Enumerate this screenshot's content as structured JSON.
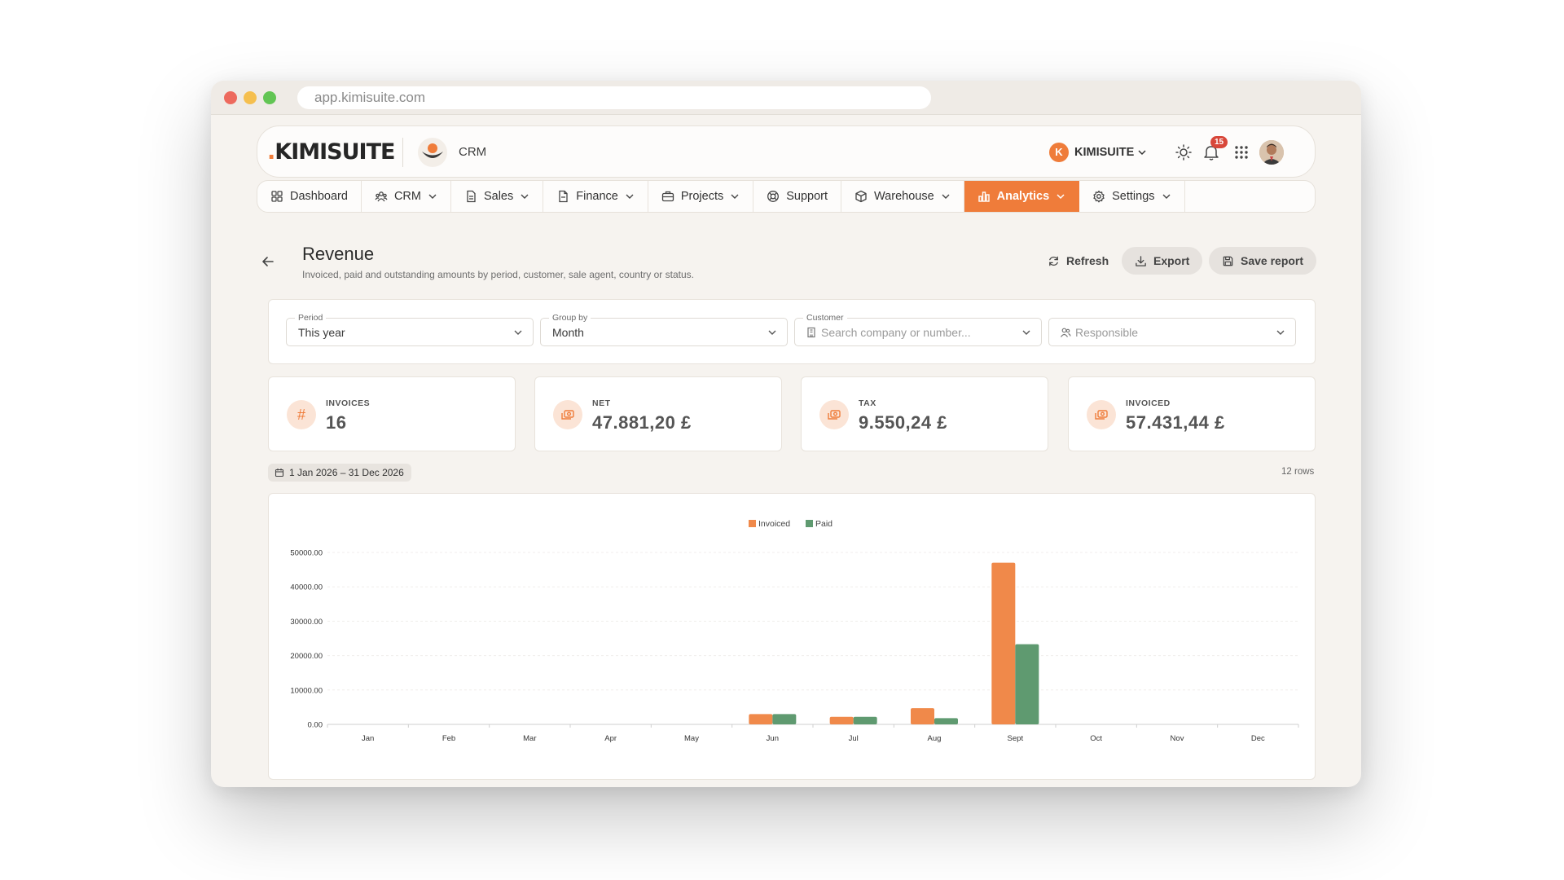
{
  "browser": {
    "url": "app.kimisuite.com"
  },
  "appbar": {
    "logo_text": ".KIMISUITE",
    "module_label": "CRM",
    "tenant_initial": "K",
    "tenant_name": "KIMISUITE",
    "notification_count": "15"
  },
  "nav": {
    "items": [
      {
        "label": "Dashboard",
        "icon": "grid-icon",
        "dropdown": false
      },
      {
        "label": "CRM",
        "icon": "users-icon",
        "dropdown": true
      },
      {
        "label": "Sales",
        "icon": "document-icon",
        "dropdown": true
      },
      {
        "label": "Finance",
        "icon": "invoice-icon",
        "dropdown": true
      },
      {
        "label": "Projects",
        "icon": "briefcase-icon",
        "dropdown": true
      },
      {
        "label": "Support",
        "icon": "lifebuoy-icon",
        "dropdown": false
      },
      {
        "label": "Warehouse",
        "icon": "box-icon",
        "dropdown": true
      },
      {
        "label": "Analytics",
        "icon": "bar-chart-icon",
        "dropdown": true,
        "active": true
      },
      {
        "label": "Settings",
        "icon": "gear-icon",
        "dropdown": true
      }
    ]
  },
  "page": {
    "title": "Revenue",
    "subtitle": "Invoiced, paid and outstanding amounts by period, customer, sale agent, country or status.",
    "refresh_label": "Refresh",
    "export_label": "Export",
    "save_label": "Save report"
  },
  "filters": {
    "period": {
      "label": "Period",
      "value": "This year"
    },
    "group_by": {
      "label": "Group by",
      "value": "Month"
    },
    "customer": {
      "label": "Customer",
      "placeholder": "Search company or number..."
    },
    "responsible": {
      "placeholder": "Responsible"
    }
  },
  "kpis": [
    {
      "label": "INVOICES",
      "value": "16",
      "icon": "hash-icon"
    },
    {
      "label": "NET",
      "value": "47.881,20 £",
      "icon": "money-icon"
    },
    {
      "label": "TAX",
      "value": "9.550,24 £",
      "icon": "money-icon"
    },
    {
      "label": "INVOICED",
      "value": "57.431,44 £",
      "icon": "money-icon"
    }
  ],
  "date_range": "1 Jan 2026 – 31 Dec 2026",
  "rows_count": "12 rows",
  "colors": {
    "accent": "#ef7c3a",
    "invoiced": "#f0894a",
    "paid": "#5f9a70"
  },
  "chart_data": {
    "type": "bar",
    "categories": [
      "Jan",
      "Feb",
      "Mar",
      "Apr",
      "May",
      "Jun",
      "Jul",
      "Aug",
      "Sept",
      "Oct",
      "Nov",
      "Dec"
    ],
    "series": [
      {
        "name": "Invoiced",
        "color": "#f0894a",
        "values": [
          0,
          0,
          0,
          0,
          0,
          3000,
          2200,
          4700,
          47000,
          0,
          0,
          0
        ]
      },
      {
        "name": "Paid",
        "color": "#5f9a70",
        "values": [
          0,
          0,
          0,
          0,
          0,
          3000,
          2200,
          1800,
          23300,
          0,
          0,
          0
        ]
      }
    ],
    "yticks": [
      "0.00",
      "10000.00",
      "20000.00",
      "30000.00",
      "40000.00",
      "50000.00"
    ],
    "ylim": [
      0,
      50000
    ],
    "legend": "top-center",
    "grid": true
  }
}
